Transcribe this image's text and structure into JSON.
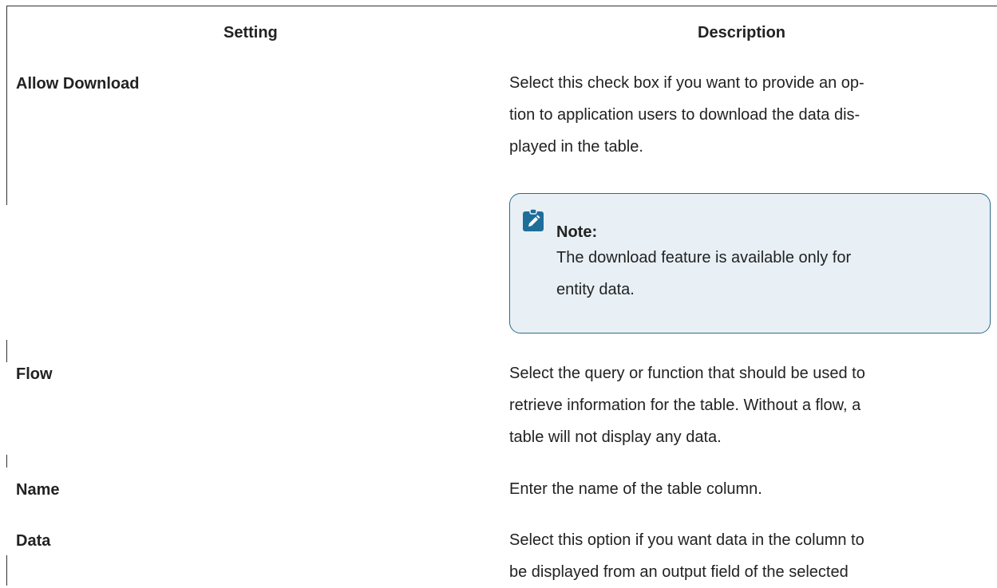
{
  "table": {
    "headers": {
      "setting": "Setting",
      "description": "Description"
    },
    "rows": [
      {
        "setting": "Allow Download",
        "description_lines": [
          "Select this check box if you want to provide an op-",
          "tion to application users to download the data dis-",
          "played in the table."
        ],
        "note": {
          "icon": "pencil-note-icon",
          "title": "Note:",
          "body_lines": [
            "The download feature is available only for",
            "entity data."
          ]
        }
      },
      {
        "setting": "Flow",
        "description_lines": [
          "Select the query or function that should be used to",
          "retrieve information for the table. Without a flow, a",
          "table will not display any data."
        ]
      },
      {
        "setting": "Name",
        "description_lines": [
          "Enter the name of the table column."
        ]
      },
      {
        "setting": "Data",
        "description_lines": [
          "Select this option if you want data in the column to",
          "be displayed from an output field of the selected"
        ]
      }
    ]
  },
  "colors": {
    "note_border": "#2e6b8a",
    "note_background": "#e8f0f6",
    "note_icon": "#1e6e9a",
    "text": "#222222"
  }
}
